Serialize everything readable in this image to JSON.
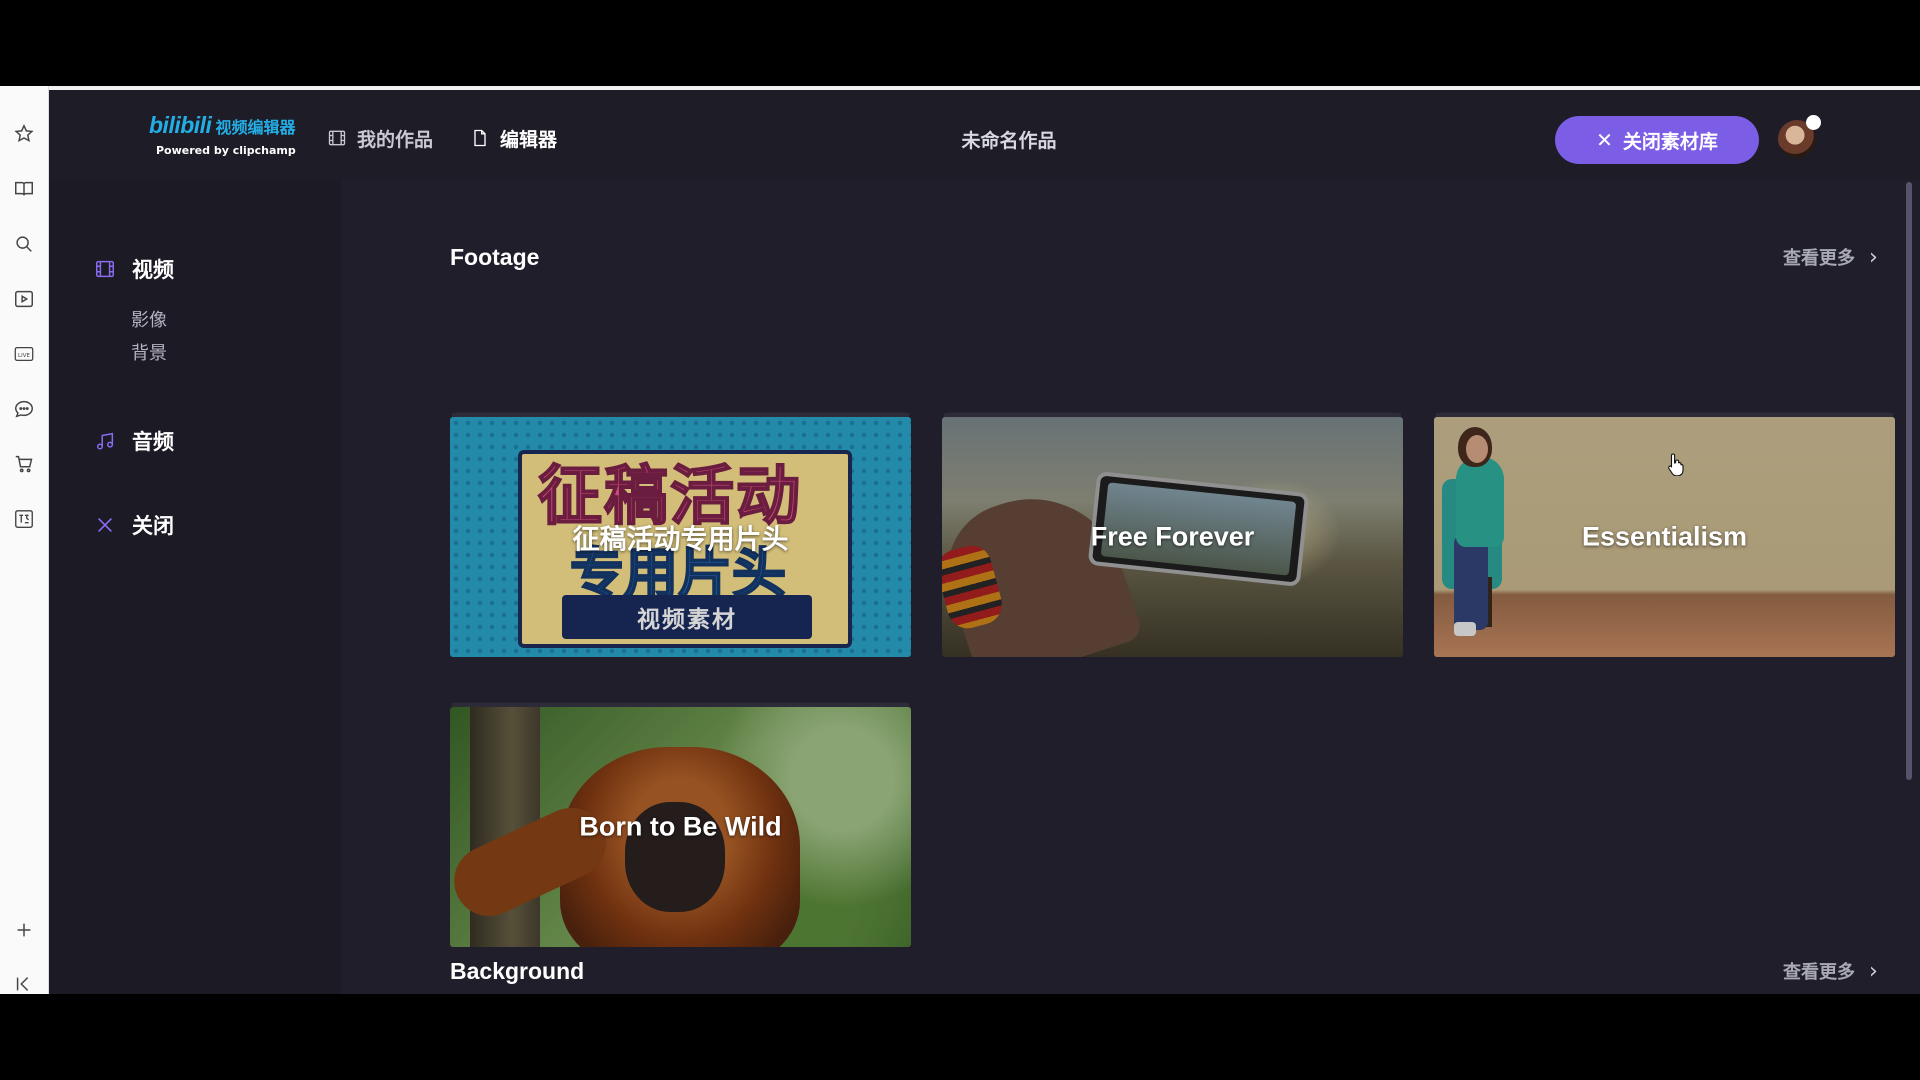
{
  "app": {
    "logo_text": "bilibili",
    "logo_cn": "视频编辑器",
    "powered_by": "Powered by clipchamp",
    "project_title": "未命名作品",
    "close_library_label": "关闭素材库"
  },
  "nav": {
    "my_works": "我的作品",
    "editor": "编辑器"
  },
  "left_panel": {
    "video": "视频",
    "sub_items": [
      "影像",
      "背景"
    ],
    "audio": "音频",
    "close": "关闭"
  },
  "sections": [
    {
      "title": "Footage",
      "see_more": "查看更多",
      "cards": [
        {
          "label": "征稿活动专用片头",
          "art_line1": "征稿活动",
          "art_line2": "专用片头",
          "art_strip": "视频素材"
        },
        {
          "label": "Free Forever"
        },
        {
          "label": "Essentialism"
        },
        {
          "label": "Born to Be Wild"
        }
      ]
    },
    {
      "title": "Background",
      "see_more": "查看更多"
    }
  ],
  "colors": {
    "accent": "#7b5de6",
    "app_bg": "#1d1c27",
    "content_bg": "#1f1e2a",
    "logo_blue": "#23ade5",
    "icon_purple": "#8b6cf0"
  },
  "icons": {
    "browser_sidebar": [
      "star-icon",
      "book-icon",
      "search-icon",
      "video-icon",
      "live-icon",
      "chat-icon",
      "cart-icon",
      "translate-icon",
      "add-icon",
      "collapse-icon"
    ]
  }
}
